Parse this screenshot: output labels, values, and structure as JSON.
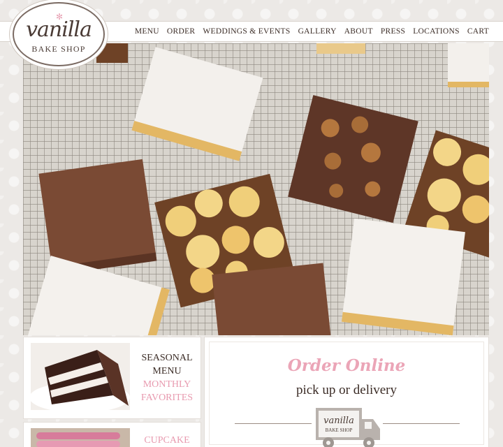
{
  "logo": {
    "script": "vanilla",
    "subtitle": "BAKE SHOP"
  },
  "nav": {
    "items": [
      {
        "label": "MENU"
      },
      {
        "label": "ORDER"
      },
      {
        "label": "WEDDINGS & EVENTS"
      },
      {
        "label": "GALLERY"
      },
      {
        "label": "ABOUT"
      },
      {
        "label": "PRESS"
      },
      {
        "label": "LOCATIONS"
      },
      {
        "label": "CART"
      }
    ]
  },
  "seasonal": {
    "line1": "SEASONAL",
    "line2": "MENU",
    "line3": "MONTHLY",
    "line4": "FAVORITES"
  },
  "cupcake": {
    "line1": "CUPCAKE"
  },
  "order": {
    "title": "Order Online",
    "subtitle": "pick up or delivery",
    "truck_script": "vanilla",
    "truck_sub": "BAKE SHOP"
  },
  "colors": {
    "pink": "#e89aaf",
    "dark_brown": "#3b2c26",
    "background": "#ece9e6"
  }
}
